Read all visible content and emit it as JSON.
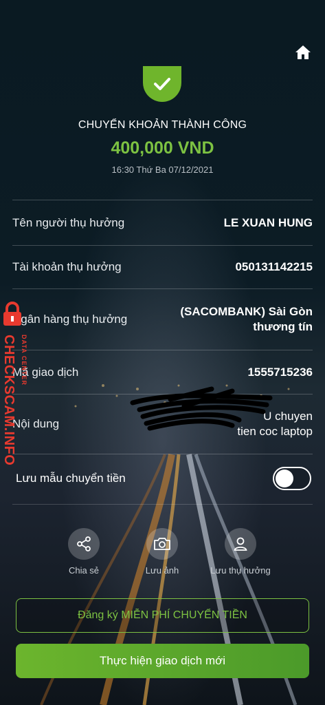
{
  "header": {
    "home_icon": "home-icon",
    "success_icon": "check-icon"
  },
  "status": {
    "title": "CHUYỂN KHOẢN THÀNH CÔNG",
    "amount": "400,000 VND",
    "datetime": "16:30 Thứ Ba 07/12/2021"
  },
  "details": {
    "beneficiary_name": {
      "label": "Tên người thụ hưởng",
      "value": "LE XUAN HUNG"
    },
    "beneficiary_account": {
      "label": "Tài khoản thụ hưởng",
      "value": "050131142215"
    },
    "beneficiary_bank": {
      "label": "Ngân hàng thụ hưởng",
      "value_line1": "(SACOMBANK) Sài Gòn",
      "value_line2": "thương tín"
    },
    "transaction_id": {
      "label": "Mã giao dịch",
      "value": "1555715236"
    },
    "content": {
      "label": "Nội dung",
      "value_line1": "U chuyen",
      "value_line2": "tien coc laptop"
    }
  },
  "save_template": {
    "label": "Lưu mẫu chuyển tiền",
    "enabled": false
  },
  "actions": [
    {
      "label": "Chia sẻ",
      "icon": "share-icon"
    },
    {
      "label": "Lưu ảnh",
      "icon": "camera-icon"
    },
    {
      "label": "Lưu thụ hưởng",
      "icon": "user-icon"
    }
  ],
  "buttons": {
    "register": "Đăng ký MIỄN PHÍ CHUYỂN TIỀN",
    "new_transaction": "Thực hiện giao dịch mới"
  },
  "watermark": {
    "brand": "CHECKSCAM.INFO",
    "sub": "DATA CENTER"
  },
  "colors": {
    "accent": "#7dc242",
    "watermark": "#e83a2f"
  }
}
